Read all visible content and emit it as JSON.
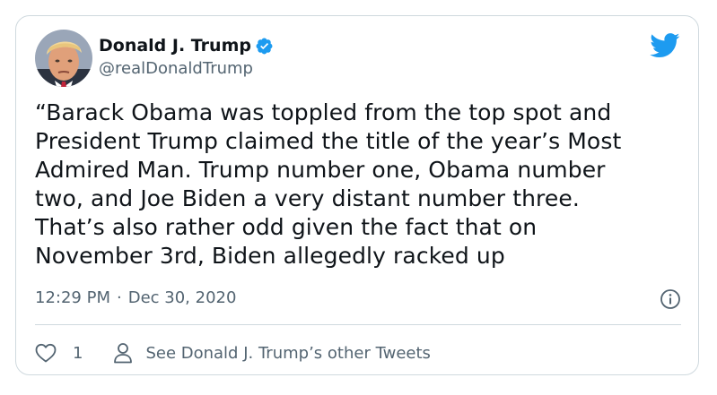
{
  "author": {
    "display_name": "Donald J. Trump",
    "handle": "@realDonaldTrump",
    "verified": true,
    "avatar_icon": "profile-photo"
  },
  "brand": {
    "icon": "twitter-bird-icon",
    "color": "#1d9bf0"
  },
  "tweet": {
    "lines": [
      "“Barack Obama was toppled from the top spot and",
      "President Trump claimed the title of the year’s Most",
      "Admired Man. Trump number one, Obama number",
      "two, and Joe Biden a very distant number three.",
      "That’s also rather odd given the fact that on",
      "November 3rd, Biden allegedly racked up"
    ],
    "time": "12:29 PM",
    "separator": "·",
    "date": "Dec 30, 2020"
  },
  "actions": {
    "like_icon": "heart-icon",
    "like_count": "1",
    "profile_icon": "person-icon",
    "other_tweets_label": "See Donald J. Trump’s other Tweets"
  },
  "info_icon": "info-icon",
  "colors": {
    "text_primary": "#0f1419",
    "text_secondary": "#536471",
    "border": "#cfd9de",
    "verified_blue": "#1d9bf0"
  }
}
